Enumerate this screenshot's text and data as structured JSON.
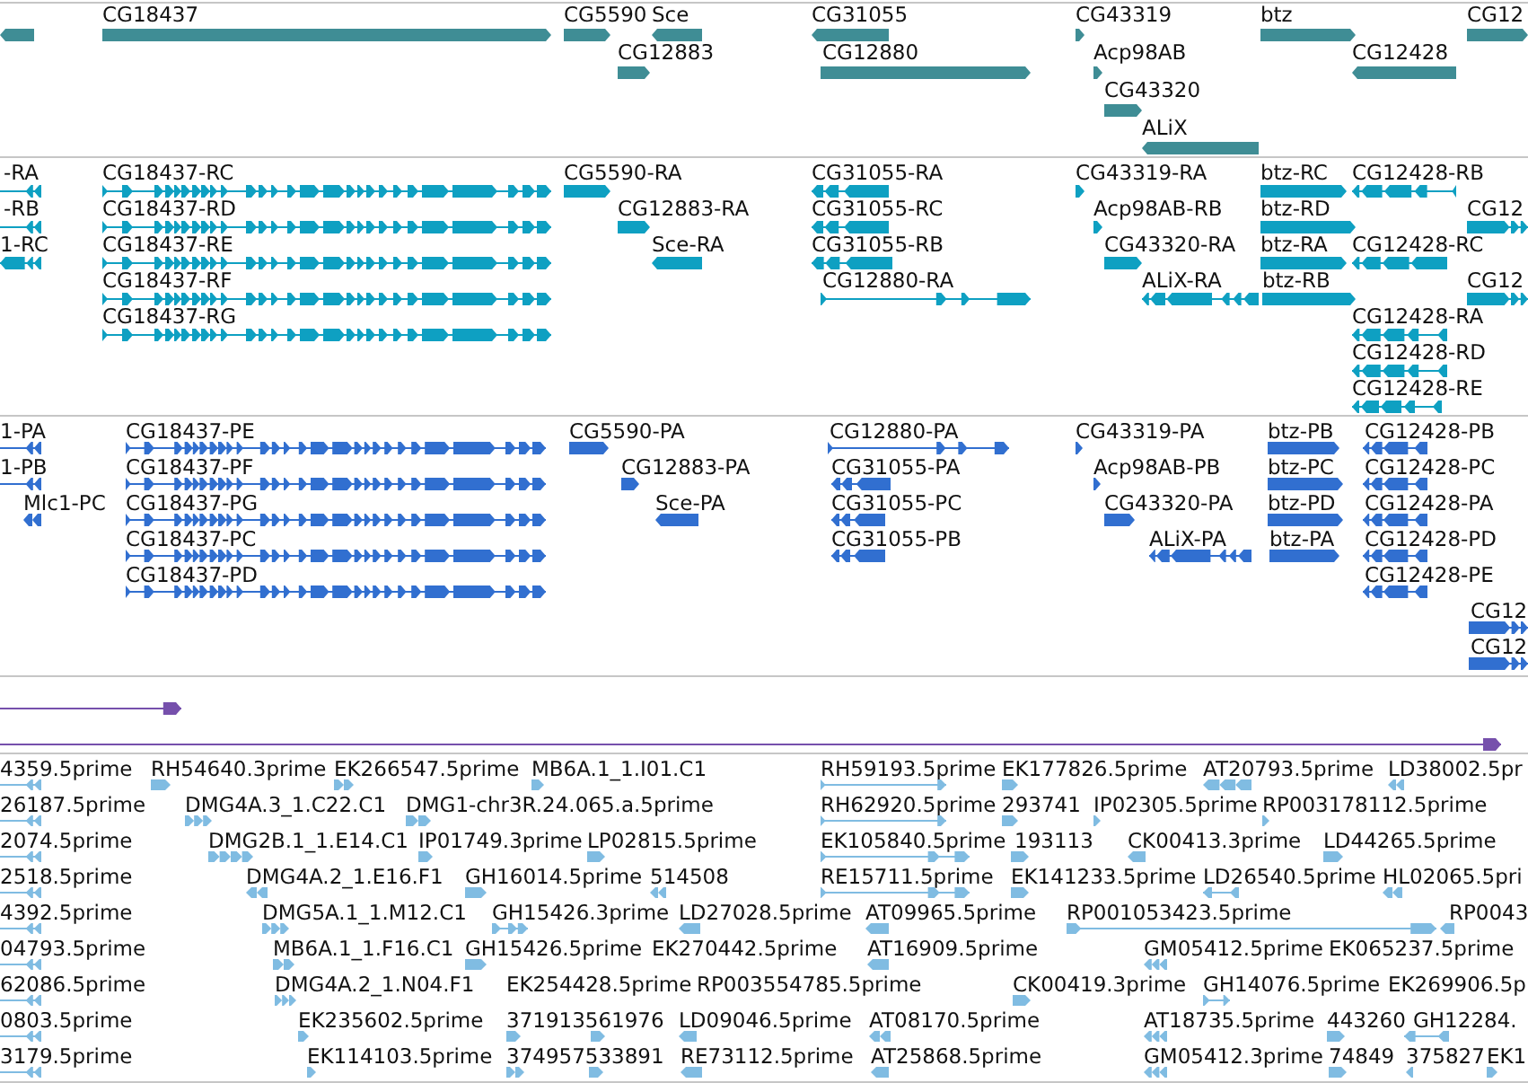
{
  "tracks": [
    {
      "kind": "gene",
      "features": [
        {
          "reverse": true
        },
        {
          "label": "CG18437",
          "reverse": false
        },
        {
          "label": "CG5590",
          "reverse": false
        },
        {
          "label": "Sce",
          "reverse": true
        },
        {
          "label": "CG12883",
          "reverse": false
        },
        {
          "label": "CG31055",
          "reverse": true
        },
        {
          "label": "CG12880",
          "reverse": false
        },
        {
          "label": "CG43319",
          "reverse": false
        },
        {
          "label": "Acp98AB",
          "reverse": false
        },
        {
          "label": "CG43320",
          "reverse": false
        },
        {
          "label": "ALiX",
          "reverse": true
        },
        {
          "label": "btz",
          "reverse": false
        },
        {
          "label": "CG12428",
          "reverse": true
        },
        {
          "label": "CG12",
          "reverse": false
        }
      ]
    },
    {
      "kind": "transcript",
      "features": [
        {
          "label": "-RA",
          "reverse": true
        },
        {
          "label": "-RB",
          "reverse": true
        },
        {
          "label": "1-RC",
          "reverse": true
        },
        {
          "label": "CG18437-RC",
          "reverse": false
        },
        {
          "label": "CG18437-RD",
          "reverse": false
        },
        {
          "label": "CG18437-RE",
          "reverse": false
        },
        {
          "label": "CG18437-RF",
          "reverse": false
        },
        {
          "label": "CG18437-RG",
          "reverse": false
        },
        {
          "label": "CG5590-RA",
          "reverse": false
        },
        {
          "label": "CG12883-RA",
          "reverse": false
        },
        {
          "label": "Sce-RA",
          "reverse": true
        },
        {
          "label": "CG31055-RA",
          "reverse": true
        },
        {
          "label": "CG31055-RC",
          "reverse": true
        },
        {
          "label": "CG31055-RB",
          "reverse": true
        },
        {
          "label": "CG12880-RA",
          "reverse": false
        },
        {
          "label": "CG43319-RA",
          "reverse": false
        },
        {
          "label": "Acp98AB-RB",
          "reverse": false
        },
        {
          "label": "CG43320-RA",
          "reverse": false
        },
        {
          "label": "ALiX-RA",
          "reverse": true
        },
        {
          "label": "btz-RC",
          "reverse": false
        },
        {
          "label": "btz-RD",
          "reverse": false
        },
        {
          "label": "btz-RA",
          "reverse": false
        },
        {
          "label": "btz-RB",
          "reverse": false
        },
        {
          "label": "CG12428-RB",
          "reverse": true
        },
        {
          "label": "CG12",
          "reverse": false
        },
        {
          "label": "CG12428-RC",
          "reverse": true
        },
        {
          "label": "CG12",
          "reverse": false
        },
        {
          "label": "CG12428-RA",
          "reverse": true
        },
        {
          "label": "CG12428-RD",
          "reverse": true
        },
        {
          "label": "CG12428-RE",
          "reverse": true
        }
      ]
    },
    {
      "kind": "protein",
      "features": [
        {
          "label": "1-PA",
          "reverse": true
        },
        {
          "label": "1-PB",
          "reverse": true
        },
        {
          "label": "Mlc1-PC",
          "reverse": true
        },
        {
          "label": "CG18437-PE",
          "reverse": false
        },
        {
          "label": "CG18437-PF",
          "reverse": false
        },
        {
          "label": "CG18437-PG",
          "reverse": false
        },
        {
          "label": "CG18437-PC",
          "reverse": false
        },
        {
          "label": "CG18437-PD",
          "reverse": false
        },
        {
          "label": "CG5590-PA",
          "reverse": false
        },
        {
          "label": "CG12883-PA",
          "reverse": false
        },
        {
          "label": "Sce-PA",
          "reverse": true
        },
        {
          "label": "CG12880-PA",
          "reverse": false
        },
        {
          "label": "CG31055-PA",
          "reverse": true
        },
        {
          "label": "CG31055-PC",
          "reverse": true
        },
        {
          "label": "CG31055-PB",
          "reverse": true
        },
        {
          "label": "CG43319-PA",
          "reverse": false
        },
        {
          "label": "Acp98AB-PB",
          "reverse": false
        },
        {
          "label": "CG43320-PA",
          "reverse": false
        },
        {
          "label": "ALiX-PA",
          "reverse": true
        },
        {
          "label": "btz-PB",
          "reverse": false
        },
        {
          "label": "btz-PC",
          "reverse": false
        },
        {
          "label": "btz-PD",
          "reverse": false
        },
        {
          "label": "btz-PA",
          "reverse": false
        },
        {
          "label": "CG12428-PB",
          "reverse": true
        },
        {
          "label": "CG12428-PC",
          "reverse": true
        },
        {
          "label": "CG12428-PA",
          "reverse": true
        },
        {
          "label": "CG12428-PD",
          "reverse": true
        },
        {
          "label": "CG12428-PE",
          "reverse": true
        },
        {
          "label": "CG12",
          "reverse": false
        },
        {
          "label": "CG12",
          "reverse": false
        }
      ]
    },
    {
      "kind": "alignment",
      "features": [
        {
          "reverse": false
        },
        {
          "reverse": false
        }
      ]
    },
    {
      "kind": "est",
      "features": [
        {
          "label": "4359.5prime",
          "reverse": true
        },
        {
          "label": "RH54640.3prime",
          "reverse": false
        },
        {
          "label": "EK266547.5prime",
          "reverse": false
        },
        {
          "label": "MB6A.1_1.I01.C1",
          "reverse": false
        },
        {
          "label": "RH59193.5prime",
          "reverse": false
        },
        {
          "label": "EK177826.5prime",
          "reverse": false
        },
        {
          "label": "AT20793.5prime",
          "reverse": true
        },
        {
          "label": "LD38002.5pr",
          "reverse": true
        },
        {
          "label": "26187.5prime",
          "reverse": true
        },
        {
          "label": "DMG4A.3_1.C22.C1",
          "reverse": false
        },
        {
          "label": "DMG1-chr3R.24.065.a.5prime",
          "reverse": false
        },
        {
          "label": "RH62920.5prime",
          "reverse": false
        },
        {
          "label": "293741",
          "reverse": false
        },
        {
          "label": "IP02305.5prime",
          "reverse": false
        },
        {
          "label": "RP003178112.5prime",
          "reverse": false
        },
        {
          "label": "2074.5prime",
          "reverse": true
        },
        {
          "label": "DMG2B.1_1.E14.C1",
          "reverse": false
        },
        {
          "label": "IP01749.3prime",
          "reverse": false
        },
        {
          "label": "LP02815.5prime",
          "reverse": false
        },
        {
          "label": "EK105840.5prime",
          "reverse": false
        },
        {
          "label": "193113",
          "reverse": false
        },
        {
          "label": "CK00413.3prime",
          "reverse": true
        },
        {
          "label": "LD44265.5prime",
          "reverse": false
        },
        {
          "label": "2518.5prime",
          "reverse": true
        },
        {
          "label": "DMG4A.2_1.E16.F1",
          "reverse": true
        },
        {
          "label": "GH16014.5prime",
          "reverse": false
        },
        {
          "label": "514508",
          "reverse": true
        },
        {
          "label": "RE15711.5prime",
          "reverse": false
        },
        {
          "label": "EK141233.5prime",
          "reverse": false
        },
        {
          "label": "LD26540.5prime",
          "reverse": true
        },
        {
          "label": "HL02065.5pri",
          "reverse": true
        },
        {
          "label": "4392.5prime",
          "reverse": true
        },
        {
          "label": "DMG5A.1_1.M12.C1",
          "reverse": false
        },
        {
          "label": "GH15426.3prime",
          "reverse": false
        },
        {
          "label": "LD27028.5prime",
          "reverse": true
        },
        {
          "label": "AT09965.5prime",
          "reverse": true
        },
        {
          "label": "RP001053423.5prime",
          "reverse": false
        },
        {
          "label": "RP0043",
          "reverse": true
        },
        {
          "label": "04793.5prime",
          "reverse": true
        },
        {
          "label": "MB6A.1_1.F16.C1",
          "reverse": false
        },
        {
          "label": "GH15426.5prime",
          "reverse": false
        },
        {
          "label": "EK270442.5prime"
        },
        {
          "label": "AT16909.5prime",
          "reverse": true
        },
        {
          "label": "GM05412.5prime",
          "reverse": true
        },
        {
          "label": "EK065237.5prime"
        },
        {
          "label": "62086.5prime",
          "reverse": true
        },
        {
          "label": "DMG4A.2_1.N04.F1",
          "reverse": false
        },
        {
          "label": "EK254428.5prime"
        },
        {
          "label": "RP003554785.5prime"
        },
        {
          "label": "CK00419.3prime",
          "reverse": false
        },
        {
          "label": "GH14076.5prime",
          "reverse": false
        },
        {
          "label": "EK269906.5p"
        },
        {
          "label": "0803.5prime",
          "reverse": true
        },
        {
          "label": "EK235602.5prime",
          "reverse": false
        },
        {
          "label": "371913561976",
          "reverse": false
        },
        {
          "reverse": false
        },
        {
          "label": "LD09046.5prime",
          "reverse": true
        },
        {
          "label": "AT08170.5prime",
          "reverse": true
        },
        {
          "label": "AT18735.5prime",
          "reverse": true
        },
        {
          "label": "443260",
          "reverse": false
        },
        {
          "label": "GH12284.",
          "reverse": true
        },
        {
          "label": "3179.5prime",
          "reverse": true
        },
        {
          "label": "EK114103.5prime",
          "reverse": false
        },
        {
          "label": "374957533891",
          "reverse": false
        },
        {
          "reverse": false
        },
        {
          "label": "RE73112.5prime",
          "reverse": true
        },
        {
          "label": "AT25868.5prime",
          "reverse": true
        },
        {
          "label": "GM05412.3prime",
          "reverse": true
        },
        {
          "label": "74849",
          "reverse": false
        },
        {
          "label": "375827",
          "reverse": true
        },
        {
          "label": "EK1",
          "reverse": false
        }
      ]
    }
  ]
}
